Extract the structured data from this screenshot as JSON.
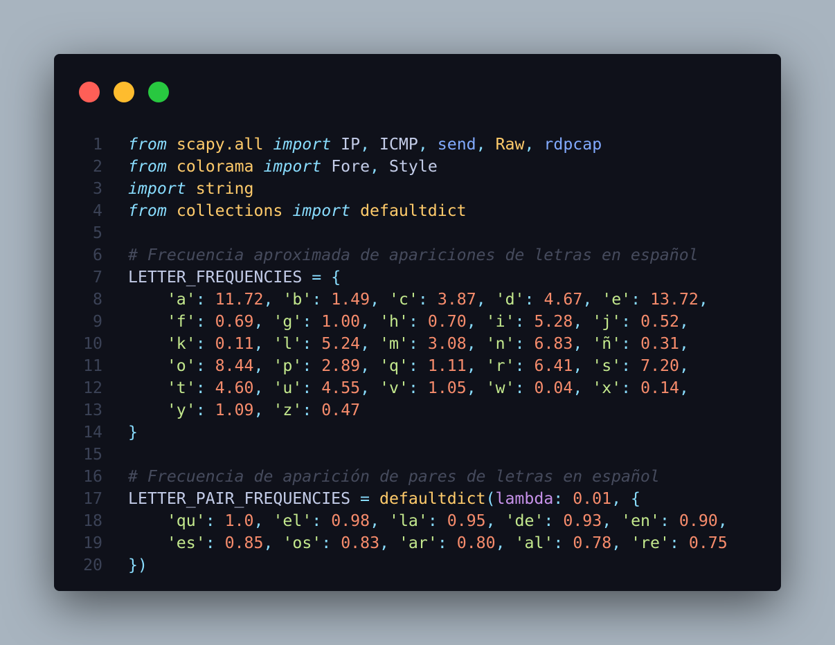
{
  "colors": {
    "background": "#a8b4bf",
    "window": "#0f111a",
    "dot_close": "#ff5f57",
    "dot_minimize": "#febc2e",
    "dot_zoom": "#28c840",
    "line_number": "#3b4256",
    "default": "#c3cce8",
    "keyword": "#89ddff",
    "module": "#ffcb6b",
    "function": "#82aaff",
    "string": "#c3e88d",
    "number": "#f78c6c",
    "comment": "#464b5d",
    "punctuation": "#89ddff",
    "lambda": "#c792ea"
  },
  "window_controls": {
    "close": "close-dot",
    "minimize": "minimize-dot",
    "zoom": "zoom-dot"
  },
  "code_lines": [
    {
      "n": "1",
      "tokens": [
        [
          "from",
          "keyword"
        ],
        [
          " ",
          "default"
        ],
        [
          "scapy.all",
          "module"
        ],
        [
          " ",
          "default"
        ],
        [
          "import",
          "keyword"
        ],
        [
          " IP",
          "default"
        ],
        [
          ",",
          "punctuation"
        ],
        [
          " ICMP",
          "default"
        ],
        [
          ",",
          "punctuation"
        ],
        [
          " ",
          "default"
        ],
        [
          "send",
          "function"
        ],
        [
          ",",
          "punctuation"
        ],
        [
          " ",
          "default"
        ],
        [
          "Raw",
          "module"
        ],
        [
          ",",
          "punctuation"
        ],
        [
          " ",
          "default"
        ],
        [
          "rdpcap",
          "function"
        ]
      ]
    },
    {
      "n": "2",
      "tokens": [
        [
          "from",
          "keyword"
        ],
        [
          " ",
          "default"
        ],
        [
          "colorama",
          "module"
        ],
        [
          " ",
          "default"
        ],
        [
          "import",
          "keyword"
        ],
        [
          " Fore",
          "default"
        ],
        [
          ",",
          "punctuation"
        ],
        [
          " Style",
          "default"
        ]
      ]
    },
    {
      "n": "3",
      "tokens": [
        [
          "import",
          "keyword"
        ],
        [
          " ",
          "default"
        ],
        [
          "string",
          "module"
        ]
      ]
    },
    {
      "n": "4",
      "tokens": [
        [
          "from",
          "keyword"
        ],
        [
          " ",
          "default"
        ],
        [
          "collections",
          "module"
        ],
        [
          " ",
          "default"
        ],
        [
          "import",
          "keyword"
        ],
        [
          " ",
          "default"
        ],
        [
          "defaultdict",
          "module"
        ]
      ]
    },
    {
      "n": "5",
      "tokens": []
    },
    {
      "n": "6",
      "tokens": [
        [
          "# Frecuencia aproximada de apariciones de letras en español",
          "comment"
        ]
      ]
    },
    {
      "n": "7",
      "tokens": [
        [
          "LETTER_FREQUENCIES ",
          "default"
        ],
        [
          "=",
          "punctuation"
        ],
        [
          " ",
          "default"
        ],
        [
          "{",
          "punctuation"
        ]
      ]
    },
    {
      "n": "8",
      "tokens": [
        [
          "    ",
          "default"
        ],
        [
          "'a'",
          "string"
        ],
        [
          ":",
          "punctuation"
        ],
        [
          " ",
          "default"
        ],
        [
          "11.72",
          "number"
        ],
        [
          ",",
          "punctuation"
        ],
        [
          " ",
          "default"
        ],
        [
          "'b'",
          "string"
        ],
        [
          ":",
          "punctuation"
        ],
        [
          " ",
          "default"
        ],
        [
          "1.49",
          "number"
        ],
        [
          ",",
          "punctuation"
        ],
        [
          " ",
          "default"
        ],
        [
          "'c'",
          "string"
        ],
        [
          ":",
          "punctuation"
        ],
        [
          " ",
          "default"
        ],
        [
          "3.87",
          "number"
        ],
        [
          ",",
          "punctuation"
        ],
        [
          " ",
          "default"
        ],
        [
          "'d'",
          "string"
        ],
        [
          ":",
          "punctuation"
        ],
        [
          " ",
          "default"
        ],
        [
          "4.67",
          "number"
        ],
        [
          ",",
          "punctuation"
        ],
        [
          " ",
          "default"
        ],
        [
          "'e'",
          "string"
        ],
        [
          ":",
          "punctuation"
        ],
        [
          " ",
          "default"
        ],
        [
          "13.72",
          "number"
        ],
        [
          ",",
          "punctuation"
        ]
      ]
    },
    {
      "n": "9",
      "tokens": [
        [
          "    ",
          "default"
        ],
        [
          "'f'",
          "string"
        ],
        [
          ":",
          "punctuation"
        ],
        [
          " ",
          "default"
        ],
        [
          "0.69",
          "number"
        ],
        [
          ",",
          "punctuation"
        ],
        [
          " ",
          "default"
        ],
        [
          "'g'",
          "string"
        ],
        [
          ":",
          "punctuation"
        ],
        [
          " ",
          "default"
        ],
        [
          "1.00",
          "number"
        ],
        [
          ",",
          "punctuation"
        ],
        [
          " ",
          "default"
        ],
        [
          "'h'",
          "string"
        ],
        [
          ":",
          "punctuation"
        ],
        [
          " ",
          "default"
        ],
        [
          "0.70",
          "number"
        ],
        [
          ",",
          "punctuation"
        ],
        [
          " ",
          "default"
        ],
        [
          "'i'",
          "string"
        ],
        [
          ":",
          "punctuation"
        ],
        [
          " ",
          "default"
        ],
        [
          "5.28",
          "number"
        ],
        [
          ",",
          "punctuation"
        ],
        [
          " ",
          "default"
        ],
        [
          "'j'",
          "string"
        ],
        [
          ":",
          "punctuation"
        ],
        [
          " ",
          "default"
        ],
        [
          "0.52",
          "number"
        ],
        [
          ",",
          "punctuation"
        ]
      ]
    },
    {
      "n": "10",
      "tokens": [
        [
          "    ",
          "default"
        ],
        [
          "'k'",
          "string"
        ],
        [
          ":",
          "punctuation"
        ],
        [
          " ",
          "default"
        ],
        [
          "0.11",
          "number"
        ],
        [
          ",",
          "punctuation"
        ],
        [
          " ",
          "default"
        ],
        [
          "'l'",
          "string"
        ],
        [
          ":",
          "punctuation"
        ],
        [
          " ",
          "default"
        ],
        [
          "5.24",
          "number"
        ],
        [
          ",",
          "punctuation"
        ],
        [
          " ",
          "default"
        ],
        [
          "'m'",
          "string"
        ],
        [
          ":",
          "punctuation"
        ],
        [
          " ",
          "default"
        ],
        [
          "3.08",
          "number"
        ],
        [
          ",",
          "punctuation"
        ],
        [
          " ",
          "default"
        ],
        [
          "'n'",
          "string"
        ],
        [
          ":",
          "punctuation"
        ],
        [
          " ",
          "default"
        ],
        [
          "6.83",
          "number"
        ],
        [
          ",",
          "punctuation"
        ],
        [
          " ",
          "default"
        ],
        [
          "'ñ'",
          "string"
        ],
        [
          ":",
          "punctuation"
        ],
        [
          " ",
          "default"
        ],
        [
          "0.31",
          "number"
        ],
        [
          ",",
          "punctuation"
        ]
      ]
    },
    {
      "n": "11",
      "tokens": [
        [
          "    ",
          "default"
        ],
        [
          "'o'",
          "string"
        ],
        [
          ":",
          "punctuation"
        ],
        [
          " ",
          "default"
        ],
        [
          "8.44",
          "number"
        ],
        [
          ",",
          "punctuation"
        ],
        [
          " ",
          "default"
        ],
        [
          "'p'",
          "string"
        ],
        [
          ":",
          "punctuation"
        ],
        [
          " ",
          "default"
        ],
        [
          "2.89",
          "number"
        ],
        [
          ",",
          "punctuation"
        ],
        [
          " ",
          "default"
        ],
        [
          "'q'",
          "string"
        ],
        [
          ":",
          "punctuation"
        ],
        [
          " ",
          "default"
        ],
        [
          "1.11",
          "number"
        ],
        [
          ",",
          "punctuation"
        ],
        [
          " ",
          "default"
        ],
        [
          "'r'",
          "string"
        ],
        [
          ":",
          "punctuation"
        ],
        [
          " ",
          "default"
        ],
        [
          "6.41",
          "number"
        ],
        [
          ",",
          "punctuation"
        ],
        [
          " ",
          "default"
        ],
        [
          "'s'",
          "string"
        ],
        [
          ":",
          "punctuation"
        ],
        [
          " ",
          "default"
        ],
        [
          "7.20",
          "number"
        ],
        [
          ",",
          "punctuation"
        ]
      ]
    },
    {
      "n": "12",
      "tokens": [
        [
          "    ",
          "default"
        ],
        [
          "'t'",
          "string"
        ],
        [
          ":",
          "punctuation"
        ],
        [
          " ",
          "default"
        ],
        [
          "4.60",
          "number"
        ],
        [
          ",",
          "punctuation"
        ],
        [
          " ",
          "default"
        ],
        [
          "'u'",
          "string"
        ],
        [
          ":",
          "punctuation"
        ],
        [
          " ",
          "default"
        ],
        [
          "4.55",
          "number"
        ],
        [
          ",",
          "punctuation"
        ],
        [
          " ",
          "default"
        ],
        [
          "'v'",
          "string"
        ],
        [
          ":",
          "punctuation"
        ],
        [
          " ",
          "default"
        ],
        [
          "1.05",
          "number"
        ],
        [
          ",",
          "punctuation"
        ],
        [
          " ",
          "default"
        ],
        [
          "'w'",
          "string"
        ],
        [
          ":",
          "punctuation"
        ],
        [
          " ",
          "default"
        ],
        [
          "0.04",
          "number"
        ],
        [
          ",",
          "punctuation"
        ],
        [
          " ",
          "default"
        ],
        [
          "'x'",
          "string"
        ],
        [
          ":",
          "punctuation"
        ],
        [
          " ",
          "default"
        ],
        [
          "0.14",
          "number"
        ],
        [
          ",",
          "punctuation"
        ]
      ]
    },
    {
      "n": "13",
      "tokens": [
        [
          "    ",
          "default"
        ],
        [
          "'y'",
          "string"
        ],
        [
          ":",
          "punctuation"
        ],
        [
          " ",
          "default"
        ],
        [
          "1.09",
          "number"
        ],
        [
          ",",
          "punctuation"
        ],
        [
          " ",
          "default"
        ],
        [
          "'z'",
          "string"
        ],
        [
          ":",
          "punctuation"
        ],
        [
          " ",
          "default"
        ],
        [
          "0.47",
          "number"
        ]
      ]
    },
    {
      "n": "14",
      "tokens": [
        [
          "}",
          "punctuation"
        ]
      ]
    },
    {
      "n": "15",
      "tokens": []
    },
    {
      "n": "16",
      "tokens": [
        [
          "# Frecuencia de aparición de pares de letras en español",
          "comment"
        ]
      ]
    },
    {
      "n": "17",
      "tokens": [
        [
          "LETTER_PAIR_FREQUENCIES ",
          "default"
        ],
        [
          "=",
          "punctuation"
        ],
        [
          " ",
          "default"
        ],
        [
          "defaultdict",
          "module"
        ],
        [
          "(",
          "punctuation"
        ],
        [
          "lambda",
          "lambda"
        ],
        [
          ":",
          "punctuation"
        ],
        [
          " ",
          "default"
        ],
        [
          "0.01",
          "number"
        ],
        [
          ",",
          "punctuation"
        ],
        [
          " ",
          "default"
        ],
        [
          "{",
          "punctuation"
        ]
      ]
    },
    {
      "n": "18",
      "tokens": [
        [
          "    ",
          "default"
        ],
        [
          "'qu'",
          "string"
        ],
        [
          ":",
          "punctuation"
        ],
        [
          " ",
          "default"
        ],
        [
          "1.0",
          "number"
        ],
        [
          ",",
          "punctuation"
        ],
        [
          " ",
          "default"
        ],
        [
          "'el'",
          "string"
        ],
        [
          ":",
          "punctuation"
        ],
        [
          " ",
          "default"
        ],
        [
          "0.98",
          "number"
        ],
        [
          ",",
          "punctuation"
        ],
        [
          " ",
          "default"
        ],
        [
          "'la'",
          "string"
        ],
        [
          ":",
          "punctuation"
        ],
        [
          " ",
          "default"
        ],
        [
          "0.95",
          "number"
        ],
        [
          ",",
          "punctuation"
        ],
        [
          " ",
          "default"
        ],
        [
          "'de'",
          "string"
        ],
        [
          ":",
          "punctuation"
        ],
        [
          " ",
          "default"
        ],
        [
          "0.93",
          "number"
        ],
        [
          ",",
          "punctuation"
        ],
        [
          " ",
          "default"
        ],
        [
          "'en'",
          "string"
        ],
        [
          ":",
          "punctuation"
        ],
        [
          " ",
          "default"
        ],
        [
          "0.90",
          "number"
        ],
        [
          ",",
          "punctuation"
        ]
      ]
    },
    {
      "n": "19",
      "tokens": [
        [
          "    ",
          "default"
        ],
        [
          "'es'",
          "string"
        ],
        [
          ":",
          "punctuation"
        ],
        [
          " ",
          "default"
        ],
        [
          "0.85",
          "number"
        ],
        [
          ",",
          "punctuation"
        ],
        [
          " ",
          "default"
        ],
        [
          "'os'",
          "string"
        ],
        [
          ":",
          "punctuation"
        ],
        [
          " ",
          "default"
        ],
        [
          "0.83",
          "number"
        ],
        [
          ",",
          "punctuation"
        ],
        [
          " ",
          "default"
        ],
        [
          "'ar'",
          "string"
        ],
        [
          ":",
          "punctuation"
        ],
        [
          " ",
          "default"
        ],
        [
          "0.80",
          "number"
        ],
        [
          ",",
          "punctuation"
        ],
        [
          " ",
          "default"
        ],
        [
          "'al'",
          "string"
        ],
        [
          ":",
          "punctuation"
        ],
        [
          " ",
          "default"
        ],
        [
          "0.78",
          "number"
        ],
        [
          ",",
          "punctuation"
        ],
        [
          " ",
          "default"
        ],
        [
          "'re'",
          "string"
        ],
        [
          ":",
          "punctuation"
        ],
        [
          " ",
          "default"
        ],
        [
          "0.75",
          "number"
        ]
      ]
    },
    {
      "n": "20",
      "tokens": [
        [
          "})",
          "punctuation"
        ]
      ]
    }
  ]
}
